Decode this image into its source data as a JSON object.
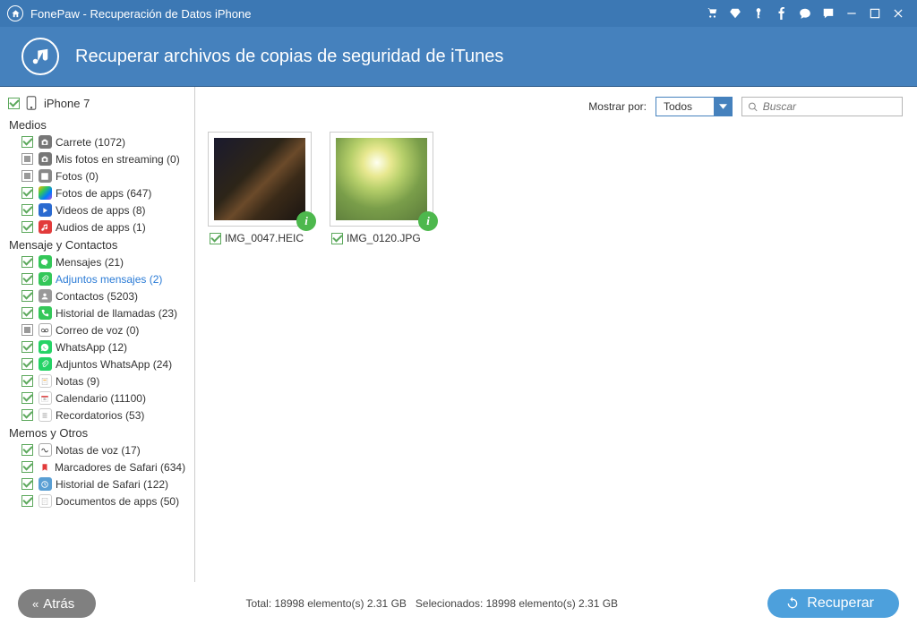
{
  "titlebar": {
    "title": "FonePaw - Recuperación de Datos iPhone"
  },
  "header": {
    "title": "Recuperar archivos de copias de seguridad de iTunes"
  },
  "sidebar": {
    "device": "iPhone 7",
    "sections": [
      {
        "title": "Medios",
        "items": [
          {
            "label": "Carrete (1072)",
            "check": "checked",
            "icon": "camera",
            "active": false
          },
          {
            "label": "Mis fotos en streaming (0)",
            "check": "partial",
            "icon": "camera",
            "active": false
          },
          {
            "label": "Fotos (0)",
            "check": "partial",
            "icon": "photo",
            "active": false
          },
          {
            "label": "Fotos de apps (647)",
            "check": "checked",
            "icon": "photo-app",
            "active": false
          },
          {
            "label": "Videos de apps (8)",
            "check": "checked",
            "icon": "video",
            "active": false
          },
          {
            "label": "Audios de apps (1)",
            "check": "checked",
            "icon": "audio",
            "active": false
          }
        ]
      },
      {
        "title": "Mensaje y Contactos",
        "items": [
          {
            "label": "Mensajes (21)",
            "check": "checked",
            "icon": "messages",
            "active": false
          },
          {
            "label": "Adjuntos mensajes (2)",
            "check": "checked",
            "icon": "attach-msg",
            "active": true
          },
          {
            "label": "Contactos (5203)",
            "check": "checked",
            "icon": "contacts",
            "active": false
          },
          {
            "label": "Historial de llamadas (23)",
            "check": "checked",
            "icon": "phone",
            "active": false
          },
          {
            "label": "Correo de voz (0)",
            "check": "partial",
            "icon": "voicemail",
            "active": false
          },
          {
            "label": "WhatsApp (12)",
            "check": "checked",
            "icon": "whatsapp",
            "active": false
          },
          {
            "label": "Adjuntos WhatsApp (24)",
            "check": "checked",
            "icon": "wa-attach",
            "active": false
          },
          {
            "label": "Notas (9)",
            "check": "checked",
            "icon": "notes",
            "active": false
          },
          {
            "label": "Calendario (11100)",
            "check": "checked",
            "icon": "calendar",
            "active": false
          },
          {
            "label": "Recordatorios (53)",
            "check": "checked",
            "icon": "reminders",
            "active": false
          }
        ]
      },
      {
        "title": "Memos y Otros",
        "items": [
          {
            "label": "Notas de voz (17)",
            "check": "checked",
            "icon": "voice-memo",
            "active": false
          },
          {
            "label": "Marcadores de Safari (634)",
            "check": "checked",
            "icon": "bookmark",
            "active": false
          },
          {
            "label": "Historial de Safari (122)",
            "check": "checked",
            "icon": "history",
            "active": false
          },
          {
            "label": "Documentos de apps (50)",
            "check": "checked",
            "icon": "docs",
            "active": false
          }
        ]
      }
    ]
  },
  "toolbar": {
    "show_by": "Mostrar por:",
    "filter_value": "Todos",
    "search_placeholder": "Buscar"
  },
  "gallery": [
    {
      "filename": "IMG_0047.HEIC",
      "check": "checked",
      "imgclass": "img1"
    },
    {
      "filename": "IMG_0120.JPG",
      "check": "checked",
      "imgclass": "img2"
    }
  ],
  "footer": {
    "back": "Atrás",
    "status": "Total: 18998 elemento(s) 2.31 GB   Selecionados: 18998 elemento(s) 2.31 GB",
    "recover": "Recuperar"
  }
}
